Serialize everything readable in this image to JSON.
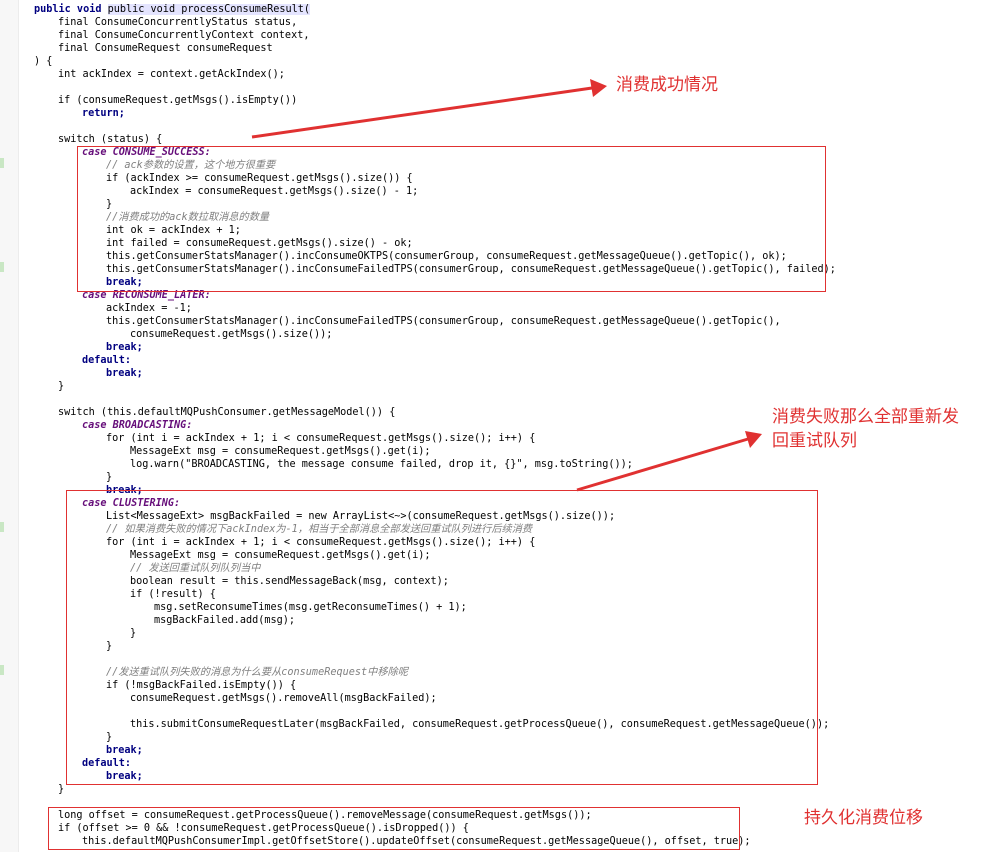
{
  "code_lines": [
    "public void processConsumeResult(",
    "final ConsumeConcurrentlyStatus status,",
    "final ConsumeConcurrentlyContext context,",
    "final ConsumeRequest consumeRequest",
    ") {",
    "int ackIndex = context.getAckIndex();",
    "",
    "if (consumeRequest.getMsgs().isEmpty())",
    "return;",
    "",
    "switch (status) {",
    "case CONSUME_SUCCESS:",
    "// ack参数的设置，这个地方很重要",
    "if (ackIndex >= consumeRequest.getMsgs().size()) {",
    "ackIndex = consumeRequest.getMsgs().size() - 1;",
    "}",
    "//消费成功的ack数拉取消息的数量",
    "int ok = ackIndex + 1;",
    "int failed = consumeRequest.getMsgs().size() - ok;",
    "this.getConsumerStatsManager().incConsumeOKTPS(consumerGroup, consumeRequest.getMessageQueue().getTopic(), ok);",
    "this.getConsumerStatsManager().incConsumeFailedTPS(consumerGroup, consumeRequest.getMessageQueue().getTopic(), failed);",
    "break;",
    "case RECONSUME_LATER:",
    "ackIndex = -1;",
    "this.getConsumerStatsManager().incConsumeFailedTPS(consumerGroup, consumeRequest.getMessageQueue().getTopic(),",
    "consumeRequest.getMsgs().size());",
    "break;",
    "default:",
    "break;",
    "}",
    "",
    "switch (this.defaultMQPushConsumer.getMessageModel()) {",
    "case BROADCASTING:",
    "for (int i = ackIndex + 1; i < consumeRequest.getMsgs().size(); i++) {",
    "MessageExt msg = consumeRequest.getMsgs().get(i);",
    "log.warn(\"BROADCASTING, the message consume failed, drop it, {}\", msg.toString());",
    "}",
    "break;",
    "case CLUSTERING:",
    "List<MessageExt> msgBackFailed = new ArrayList<~>(consumeRequest.getMsgs().size());",
    "// 如果消费失败的情况下ackIndex为-1，相当于全部消息全部发送回重试队列进行后续消费",
    "for (int i = ackIndex + 1; i < consumeRequest.getMsgs().size(); i++) {",
    "MessageExt msg = consumeRequest.getMsgs().get(i);",
    "// 发送回重试队列队列当中",
    "boolean result = this.sendMessageBack(msg, context);",
    "if (!result) {",
    "msg.setReconsumeTimes(msg.getReconsumeTimes() + 1);",
    "msgBackFailed.add(msg);",
    "}",
    "}",
    "",
    "//发送重试队列失败的消息为什么要从consumeRequest中移除呢",
    "if (!msgBackFailed.isEmpty()) {",
    "consumeRequest.getMsgs().removeAll(msgBackFailed);",
    "",
    "this.submitConsumeRequestLater(msgBackFailed, consumeRequest.getProcessQueue(), consumeRequest.getMessageQueue());",
    "}",
    "break;",
    "default:",
    "break;",
    "}",
    "",
    "long offset = consumeRequest.getProcessQueue().removeMessage(consumeRequest.getMsgs());",
    "if (offset >= 0 && !consumeRequest.getProcessQueue().isDropped()) {",
    "this.defaultMQPushConsumerImpl.getOffsetStore().updateOffset(consumeRequest.getMessageQueue(), offset, true);"
  ],
  "annotations": {
    "success": "消费成功情况",
    "failure_line1": "消费失败那么全部重新发",
    "failure_line2": "回重试队列",
    "persist": "持久化消费位移"
  },
  "colors": {
    "annotation": "#e03131",
    "keyword": "#000080",
    "comment": "#808080",
    "constant": "#660e7a",
    "number": "#0000ff",
    "string": "#008000"
  }
}
